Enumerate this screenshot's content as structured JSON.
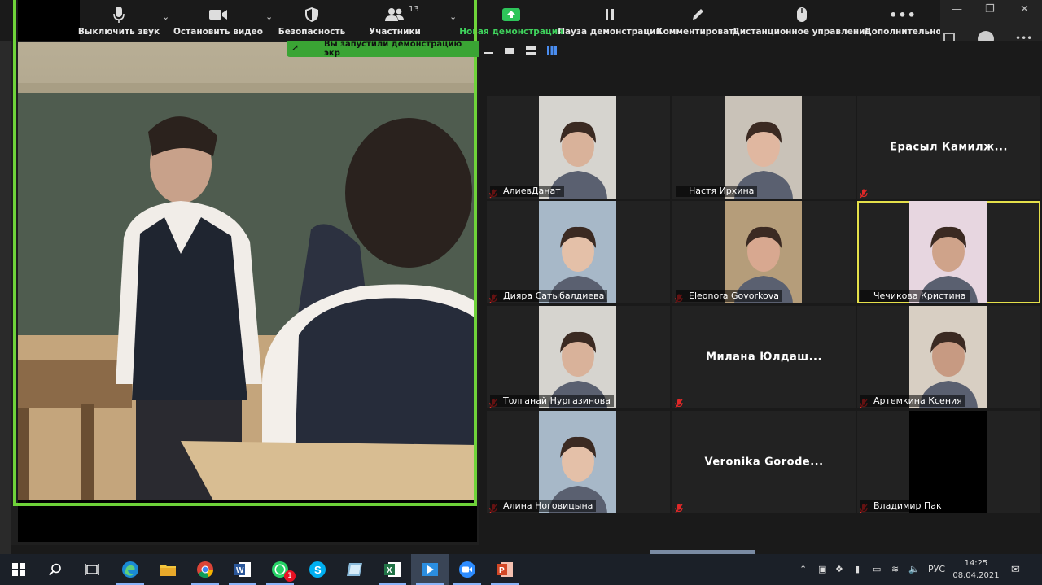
{
  "toolbar": {
    "mute_label": "Выключить звук",
    "stop_video_label": "Остановить видео",
    "security_label": "Безопасность",
    "participants_label": "Участники",
    "participants_count": "13",
    "new_share_label": "Новая демонстрация",
    "pause_share_label": "Пауза демонстрации",
    "annotate_label": "Комментировать",
    "remote_control_label": "Дистанционное управление",
    "more_label": "Дополнительно"
  },
  "share_banner": {
    "text": "Вы запустили демонстрацию экр"
  },
  "gallery": {
    "tiles": [
      {
        "name": "АлиевДанат",
        "muted": true,
        "has_video": true
      },
      {
        "name": "Настя Ирхина",
        "muted": false,
        "has_video": true
      },
      {
        "name": "Ерасыл Камилж...",
        "muted": true,
        "has_video": false
      },
      {
        "name": "Дияра Сатыбалдиева",
        "muted": true,
        "has_video": true
      },
      {
        "name": "Eleonora Govorkova",
        "muted": true,
        "has_video": true
      },
      {
        "name": "Чечикова Кристина",
        "muted": false,
        "has_video": true,
        "active_speaker": true
      },
      {
        "name": "Толганай Нургазинова",
        "muted": true,
        "has_video": true
      },
      {
        "name": "Милана Юлдаш...",
        "muted": true,
        "has_video": false
      },
      {
        "name": "Артемкина Ксения",
        "muted": true,
        "has_video": true
      },
      {
        "name": "Алина Ноговицына",
        "muted": true,
        "has_video": true
      },
      {
        "name": "Veronika Gorode...",
        "muted": true,
        "has_video": false
      },
      {
        "name": "Владимир Пак",
        "muted": true,
        "has_video": true
      }
    ]
  },
  "taskbar": {
    "language": "РУС",
    "time": "14:25",
    "date": "08.04.2021",
    "whatsapp_badge": "1"
  },
  "colors": {
    "share_border": "#6fd33a",
    "new_share_icon": "#2ec55a",
    "active_speaker": "#e5e04a",
    "muted_red": "#e02828",
    "taskbar": "#1b2028"
  }
}
